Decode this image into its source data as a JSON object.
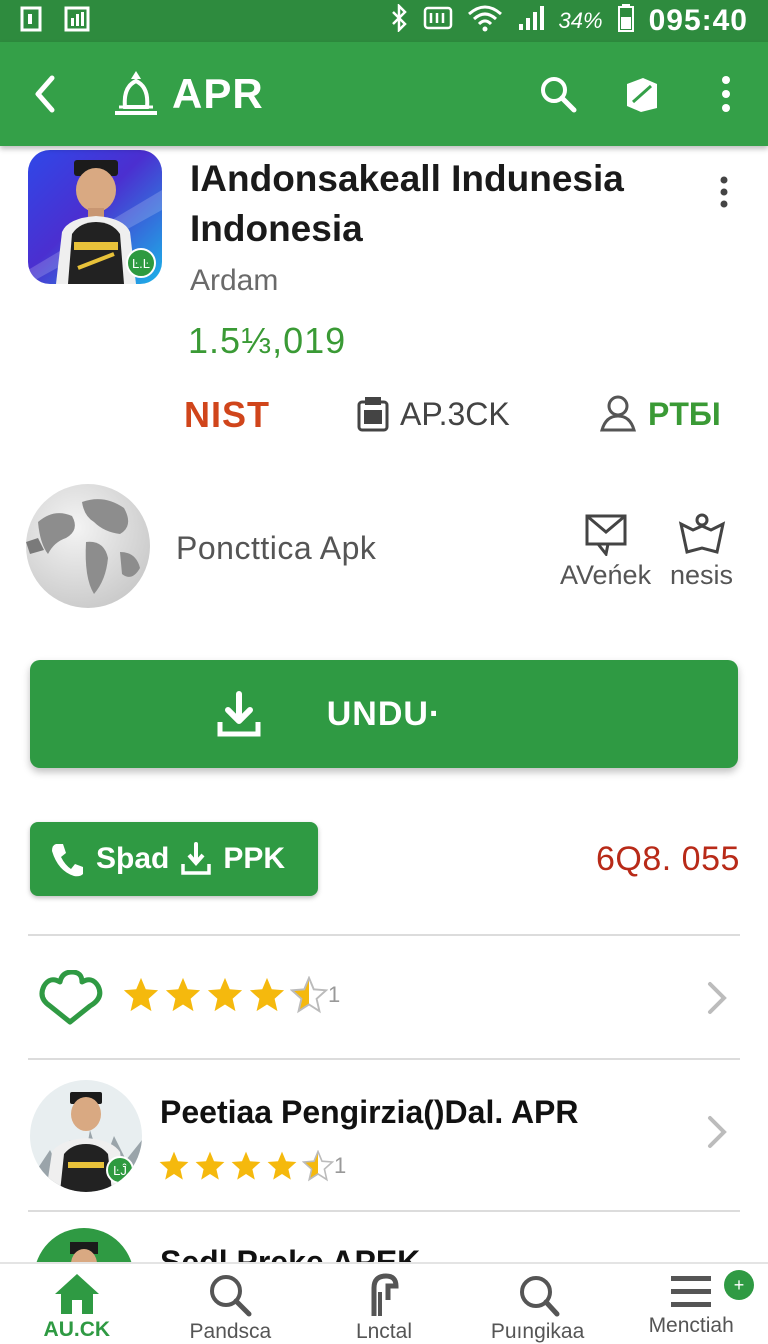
{
  "status_bar": {
    "battery_text": "34%",
    "time": "095:40"
  },
  "app_bar": {
    "title": "APR"
  },
  "app": {
    "title_line1": "IAndonsakeall Indunesia",
    "title_line2": "Indonesia",
    "developer": "Ardam",
    "count": "1.5⅓,019",
    "verified_badge": "Ŀ.Ŀ"
  },
  "meta": {
    "tag": "NIST",
    "package_label": "AP.3CK",
    "audience_label": "PTБI"
  },
  "globe_row": {
    "label": "Poncttica  Apk",
    "action1_label": "AVeńek",
    "action2_label": "nesis"
  },
  "download": {
    "label": "UNDU·"
  },
  "secondary": {
    "label": "Sþad",
    "label2": "PPK",
    "size": "6Q8. 055"
  },
  "rating": {
    "stars": 4.5,
    "suffix": "1"
  },
  "review": {
    "title": "Peetiaa Pengirzia()Dal. APR",
    "stars": 4.5,
    "suffix": "1",
    "verified_badge": "ĿĴ"
  },
  "partial": {
    "title": "Sedl Preke APEK"
  },
  "bottom_nav": [
    {
      "label": "AU.CK",
      "icon": "home-icon"
    },
    {
      "label": "Pandsca",
      "icon": "search-icon"
    },
    {
      "label": "Lnctal",
      "icon": "hook-icon"
    },
    {
      "label": "Puıngikaa",
      "icon": "search-icon"
    },
    {
      "label": "Menctiah",
      "icon": "menu-icon"
    }
  ],
  "bottom_nav_badge": "+",
  "colors": {
    "primary": "#34a048",
    "status_bar": "#2e8b3e",
    "accent_orange": "#d0451b",
    "size_red": "#b82a18",
    "star": "#f5b90d"
  }
}
